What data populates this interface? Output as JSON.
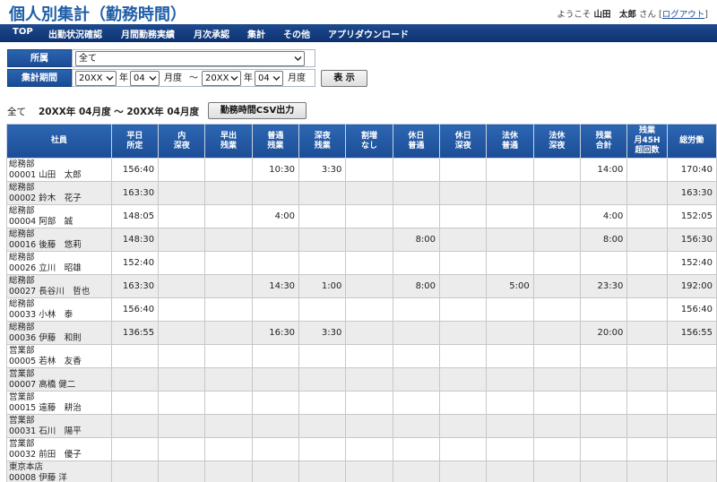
{
  "header": {
    "title": "個人別集計（勤務時間）",
    "welcome_prefix": "ようこそ",
    "user_name": "山田　太郎",
    "welcome_suffix": "さん",
    "logout_open": "[",
    "logout_label": "ログアウト",
    "logout_close": "]"
  },
  "nav": {
    "items": [
      "TOP",
      "出勤状況確認",
      "月間勤務実績",
      "月次承認",
      "集計",
      "その他",
      "アプリダウンロード"
    ]
  },
  "filter": {
    "dept_label": "所属",
    "dept_value": "全て",
    "period_label": "集計期間",
    "from_year": "20XX",
    "year_unit": "年",
    "from_month": "04",
    "month_unit": "月度",
    "tilde": "～",
    "to_year": "20XX",
    "to_month": "04",
    "show_button": "表 示"
  },
  "summary": {
    "dept": "全て",
    "range": "20XX年 04月度 ～ 20XX年 04月度",
    "csv_button": "勤務時間CSV出力"
  },
  "table": {
    "headers": [
      [
        "社員"
      ],
      [
        "平日",
        "所定"
      ],
      [
        "内",
        "深夜"
      ],
      [
        "早出",
        "残業"
      ],
      [
        "普通",
        "残業"
      ],
      [
        "深夜",
        "残業"
      ],
      [
        "割増",
        "なし"
      ],
      [
        "休日",
        "普通"
      ],
      [
        "休日",
        "深夜"
      ],
      [
        "法休",
        "普通"
      ],
      [
        "法休",
        "深夜"
      ],
      [
        "残業",
        "合計"
      ],
      [
        "残業",
        "月45H",
        "超回数"
      ],
      [
        "総労働"
      ]
    ],
    "rows": [
      {
        "dept": "総務部",
        "emp": "00001 山田　太郎",
        "cells": [
          "156:40",
          "",
          "",
          "10:30",
          "3:30",
          "",
          "",
          "",
          "",
          "",
          "14:00",
          "",
          "170:40"
        ]
      },
      {
        "dept": "総務部",
        "emp": "00002 鈴木　花子",
        "cells": [
          "163:30",
          "",
          "",
          "",
          "",
          "",
          "",
          "",
          "",
          "",
          "",
          "",
          "163:30"
        ]
      },
      {
        "dept": "総務部",
        "emp": "00004 阿部　誠",
        "cells": [
          "148:05",
          "",
          "",
          "4:00",
          "",
          "",
          "",
          "",
          "",
          "",
          "4:00",
          "",
          "152:05"
        ]
      },
      {
        "dept": "総務部",
        "emp": "00016 後藤　悠莉",
        "cells": [
          "148:30",
          "",
          "",
          "",
          "",
          "",
          "8:00",
          "",
          "",
          "",
          "8:00",
          "",
          "156:30"
        ]
      },
      {
        "dept": "総務部",
        "emp": "00026 立川　昭雄",
        "cells": [
          "152:40",
          "",
          "",
          "",
          "",
          "",
          "",
          "",
          "",
          "",
          "",
          "",
          "152:40"
        ]
      },
      {
        "dept": "総務部",
        "emp": "00027 長谷川　哲也",
        "cells": [
          "163:30",
          "",
          "",
          "14:30",
          "1:00",
          "",
          "8:00",
          "",
          "5:00",
          "",
          "23:30",
          "",
          "192:00"
        ]
      },
      {
        "dept": "総務部",
        "emp": "00033 小林　泰",
        "cells": [
          "156:40",
          "",
          "",
          "",
          "",
          "",
          "",
          "",
          "",
          "",
          "",
          "",
          "156:40"
        ]
      },
      {
        "dept": "総務部",
        "emp": "00036 伊藤　和則",
        "cells": [
          "136:55",
          "",
          "",
          "16:30",
          "3:30",
          "",
          "",
          "",
          "",
          "",
          "20:00",
          "",
          "156:55"
        ]
      },
      {
        "dept": "営業部",
        "emp": "00005 若林　友香",
        "cells": [
          "",
          "",
          "",
          "",
          "",
          "",
          "",
          "",
          "",
          "",
          "",
          "",
          ""
        ]
      },
      {
        "dept": "営業部",
        "emp": "00007 高橋 健二",
        "cells": [
          "",
          "",
          "",
          "",
          "",
          "",
          "",
          "",
          "",
          "",
          "",
          "",
          ""
        ]
      },
      {
        "dept": "営業部",
        "emp": "00015 遠藤　耕治",
        "cells": [
          "",
          "",
          "",
          "",
          "",
          "",
          "",
          "",
          "",
          "",
          "",
          "",
          ""
        ]
      },
      {
        "dept": "営業部",
        "emp": "00031 石川　陽平",
        "cells": [
          "",
          "",
          "",
          "",
          "",
          "",
          "",
          "",
          "",
          "",
          "",
          "",
          ""
        ]
      },
      {
        "dept": "営業部",
        "emp": "00032 前田　優子",
        "cells": [
          "",
          "",
          "",
          "",
          "",
          "",
          "",
          "",
          "",
          "",
          "",
          "",
          ""
        ]
      },
      {
        "dept": "東京本店",
        "emp": "00008 伊藤 洋",
        "cells": [
          "",
          "",
          "",
          "",
          "",
          "",
          "",
          "",
          "",
          "",
          "",
          "",
          ""
        ]
      }
    ]
  }
}
